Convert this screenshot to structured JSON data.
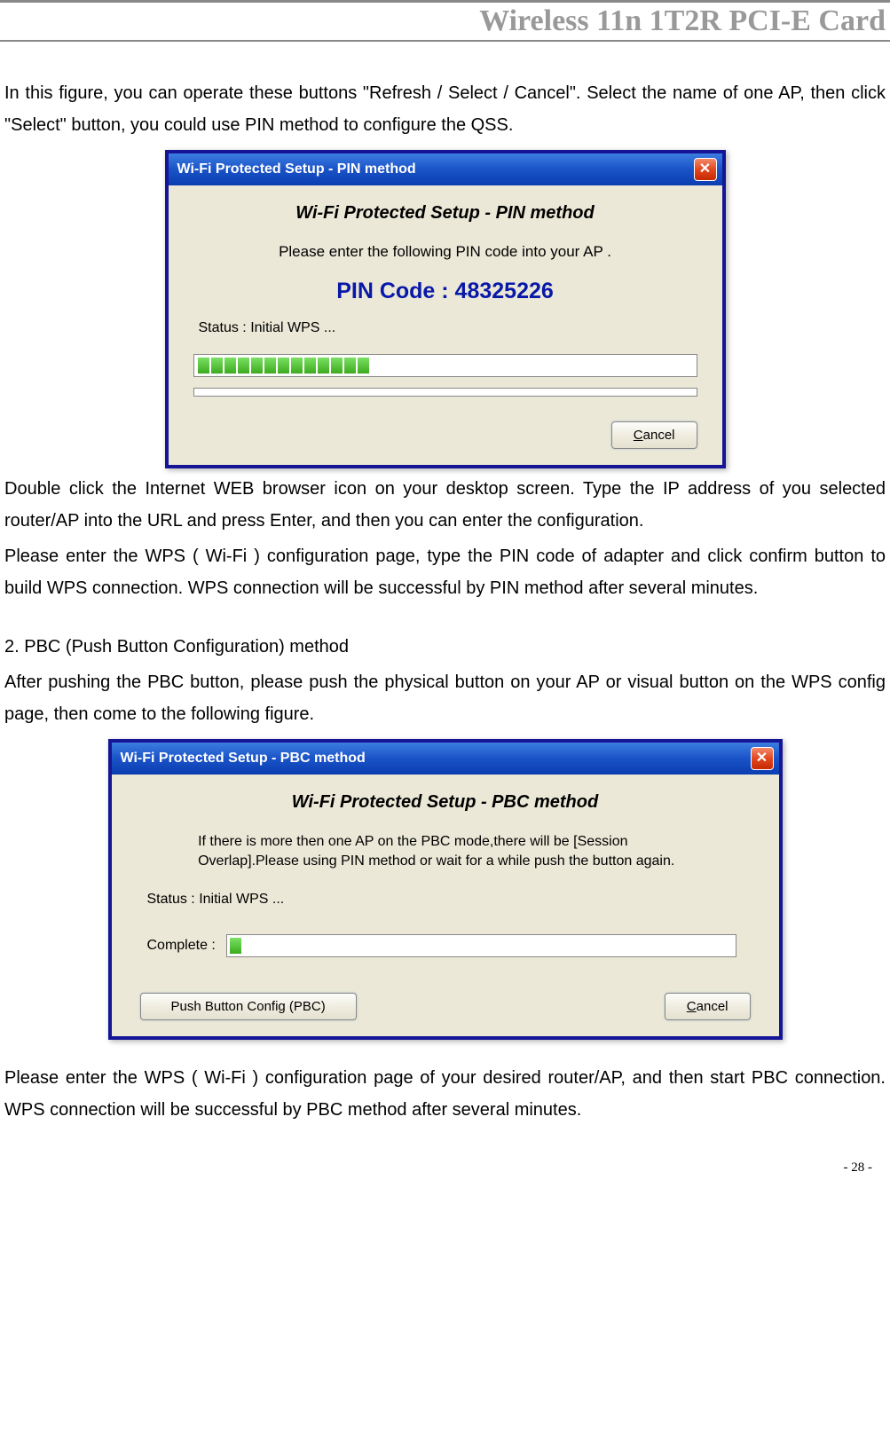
{
  "header": {
    "title": "Wireless 11n 1T2R PCI-E Card"
  },
  "paragraphs": {
    "p1": "In this figure, you can operate these buttons \"Refresh / Select / Cancel\". Select the name of one AP, then click \"Select\" button, you could use PIN method to configure the QSS.",
    "p2": "Double click the Internet WEB browser icon on your desktop screen. Type the IP address of you selected router/AP into the URL and press Enter, and then you can enter the configuration.",
    "p3": "Please enter the WPS ( Wi-Fi ) configuration page, type the PIN code of adapter and click confirm button to build WPS connection. WPS connection will be successful by PIN method after several minutes.",
    "p4_heading": "2. PBC (Push Button Configuration) method",
    "p5": "After pushing the PBC button, please push the physical button on your AP or visual button on the WPS config page, then come to the following figure.",
    "p6": "Please enter the WPS ( Wi-Fi ) configuration page of your desired router/AP, and then start PBC connection. WPS connection will be successful by PBC method after several minutes."
  },
  "dialog_pin": {
    "title": "Wi-Fi Protected Setup - PIN method",
    "heading": "Wi-Fi Protected Setup - PIN method",
    "instruction": "Please enter the following PIN code into your AP .",
    "pin_label": "PIN Code :  ",
    "pin_value": "48325226",
    "status": "Status :   Initial WPS ...",
    "cancel_btn": "ancel",
    "cancel_prefix": "C"
  },
  "dialog_pbc": {
    "title": "Wi-Fi Protected Setup - PBC method",
    "heading": "Wi-Fi Protected Setup - PBC method",
    "info": "If there is more then one AP on the PBC mode,there will be [Session Overlap].Please using PIN method or wait for a while push the button again.",
    "status": "Status : Initial WPS ...",
    "complete_label": "Complete :",
    "pbc_btn": "Push Button Config (PBC)",
    "cancel_btn": "ancel",
    "cancel_prefix": "C"
  },
  "footer": {
    "page": "- 28 -"
  }
}
